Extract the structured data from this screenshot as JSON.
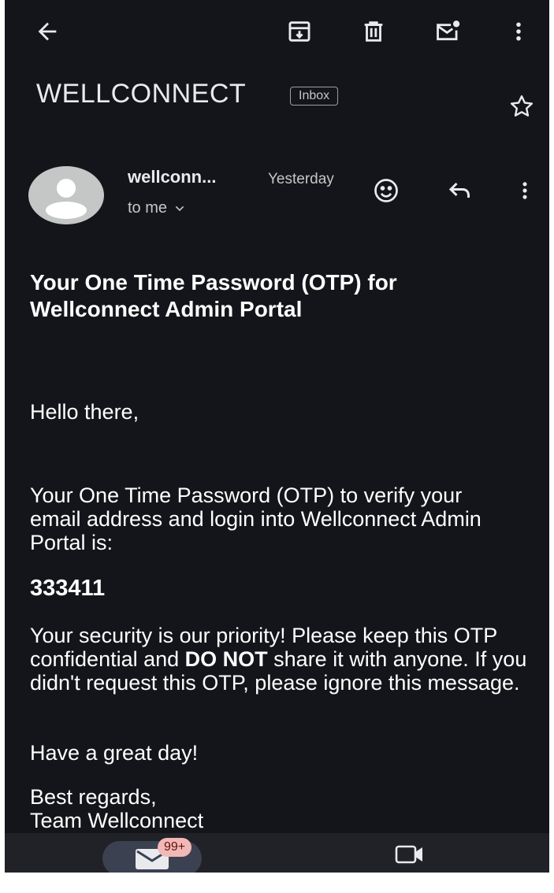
{
  "toolbar": {
    "icons": [
      "back-arrow-icon",
      "archive-icon",
      "delete-icon",
      "mark-unread-icon",
      "more-vert-icon"
    ]
  },
  "email": {
    "subject_sender": "WELLCONNECT",
    "label_chip": "Inbox",
    "from_name": "wellconn...",
    "date": "Yesterday",
    "to": "to me",
    "title": "Your One Time Password (OTP) for Wellconnect Admin Portal",
    "greeting": "Hello there,",
    "intro": "Your One Time Password (OTP) to verify your email address and login into Wellconnect Admin Portal is:",
    "otp_code": "333411",
    "security_pre": "Your security is our priority! Please keep this OTP confidential and ",
    "security_bold": "DO NOT",
    "security_post": " share it with anyone. If you didn't request this OTP, please ignore this message.",
    "closing": "Have a great day!",
    "regards": "Best regards,",
    "signature": "Team Wellconnect"
  },
  "bottom_nav": {
    "mail_badge": "99+",
    "icons": [
      "mail-icon",
      "video-icon"
    ]
  },
  "colors": {
    "background": "#14151a",
    "text": "#e8eaed",
    "nav_pill": "#3b4151",
    "badge": "#f2b8b5"
  }
}
